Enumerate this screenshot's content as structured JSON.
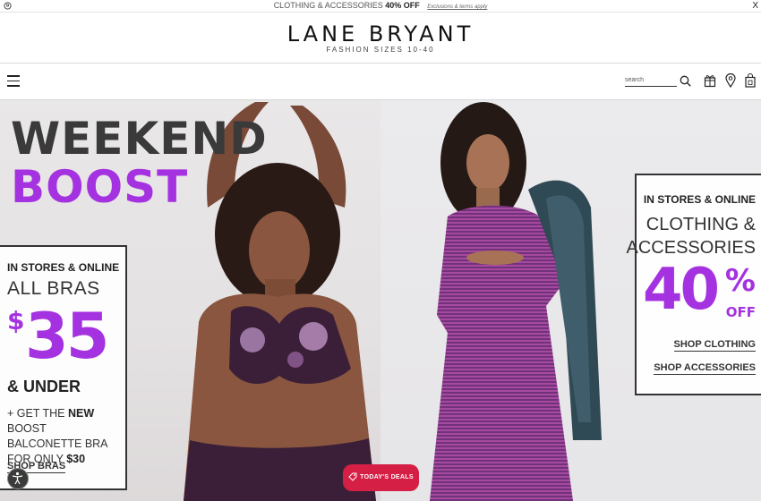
{
  "promo": {
    "prefix": "CLOTHING & ACCESSORIES",
    "discount": "40% OFF",
    "terms": "Exclusions & terms apply",
    "close": "X"
  },
  "header": {
    "logo": "LANE BRYANT",
    "tagline": "FASHION SIZES 10-40"
  },
  "nav": {
    "search_placeholder": "search"
  },
  "hero": {
    "headline_1": "WEEKEND",
    "headline_2": "BOOST",
    "left_offer": {
      "channel": "IN STORES & ONLINE",
      "category": "ALL BRAS",
      "currency": "$",
      "price": "35",
      "qualifier": "& UNDER",
      "note_prefix": "+ GET THE",
      "note_strong": "NEW",
      "note_middle": "BOOST BALCONETTE BRA FOR ONLY",
      "note_price": "$30",
      "link": "SHOP BRAS"
    },
    "right_offer": {
      "channel": "IN STORES & ONLINE",
      "line_1": "CLOTHING &",
      "line_2": "ACCESSORIES",
      "percent": "40",
      "percent_symbol": "%",
      "off": "OFF",
      "link_1": "SHOP CLOTHING",
      "link_2": "SHOP ACCESSORIES"
    }
  },
  "deals_button": "TODAY'S DEALS",
  "colors": {
    "accent": "#a532e0",
    "deals": "#d51f45"
  }
}
